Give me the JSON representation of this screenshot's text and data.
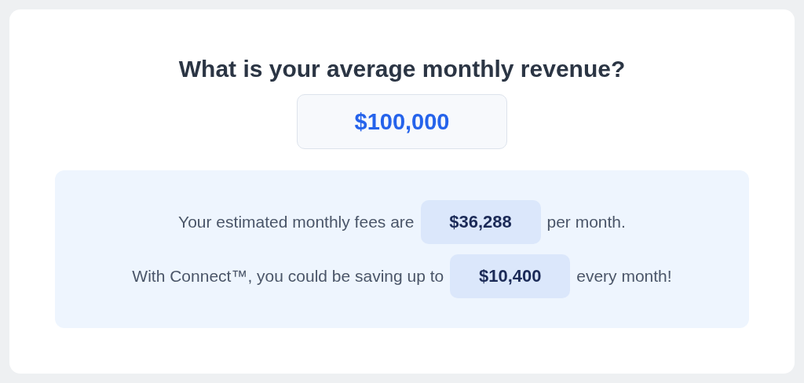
{
  "question": "What is your average monthly revenue?",
  "revenue_field": {
    "value": "$100,000"
  },
  "results": [
    {
      "before": "Your estimated monthly fees are",
      "amount": "$36,288",
      "after": "per month."
    },
    {
      "before": "With Connect™, you could be saving up to",
      "amount": "$10,400",
      "after": "every month!"
    }
  ]
}
